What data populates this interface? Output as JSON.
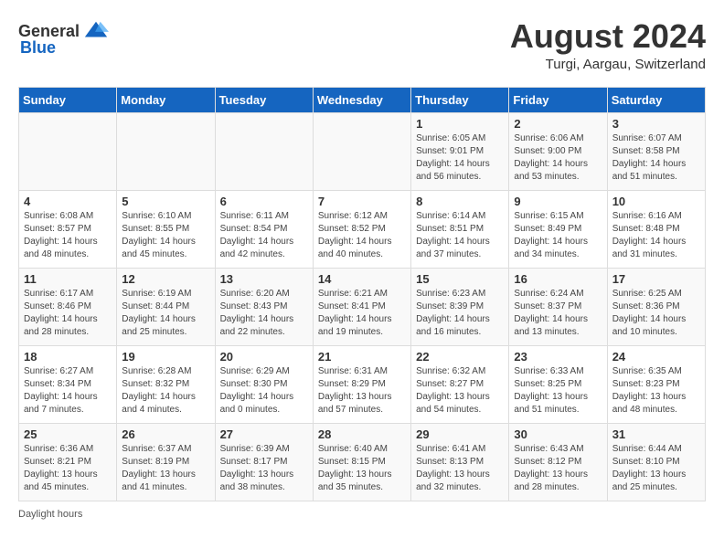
{
  "header": {
    "logo_general": "General",
    "logo_blue": "Blue",
    "month_title": "August 2024",
    "location": "Turgi, Aargau, Switzerland"
  },
  "columns": [
    "Sunday",
    "Monday",
    "Tuesday",
    "Wednesday",
    "Thursday",
    "Friday",
    "Saturday"
  ],
  "footer": {
    "label": "Daylight hours"
  },
  "weeks": [
    {
      "days": [
        {
          "num": "",
          "content": ""
        },
        {
          "num": "",
          "content": ""
        },
        {
          "num": "",
          "content": ""
        },
        {
          "num": "",
          "content": ""
        },
        {
          "num": "1",
          "content": "Sunrise: 6:05 AM\nSunset: 9:01 PM\nDaylight: 14 hours\nand 56 minutes."
        },
        {
          "num": "2",
          "content": "Sunrise: 6:06 AM\nSunset: 9:00 PM\nDaylight: 14 hours\nand 53 minutes."
        },
        {
          "num": "3",
          "content": "Sunrise: 6:07 AM\nSunset: 8:58 PM\nDaylight: 14 hours\nand 51 minutes."
        }
      ]
    },
    {
      "days": [
        {
          "num": "4",
          "content": "Sunrise: 6:08 AM\nSunset: 8:57 PM\nDaylight: 14 hours\nand 48 minutes."
        },
        {
          "num": "5",
          "content": "Sunrise: 6:10 AM\nSunset: 8:55 PM\nDaylight: 14 hours\nand 45 minutes."
        },
        {
          "num": "6",
          "content": "Sunrise: 6:11 AM\nSunset: 8:54 PM\nDaylight: 14 hours\nand 42 minutes."
        },
        {
          "num": "7",
          "content": "Sunrise: 6:12 AM\nSunset: 8:52 PM\nDaylight: 14 hours\nand 40 minutes."
        },
        {
          "num": "8",
          "content": "Sunrise: 6:14 AM\nSunset: 8:51 PM\nDaylight: 14 hours\nand 37 minutes."
        },
        {
          "num": "9",
          "content": "Sunrise: 6:15 AM\nSunset: 8:49 PM\nDaylight: 14 hours\nand 34 minutes."
        },
        {
          "num": "10",
          "content": "Sunrise: 6:16 AM\nSunset: 8:48 PM\nDaylight: 14 hours\nand 31 minutes."
        }
      ]
    },
    {
      "days": [
        {
          "num": "11",
          "content": "Sunrise: 6:17 AM\nSunset: 8:46 PM\nDaylight: 14 hours\nand 28 minutes."
        },
        {
          "num": "12",
          "content": "Sunrise: 6:19 AM\nSunset: 8:44 PM\nDaylight: 14 hours\nand 25 minutes."
        },
        {
          "num": "13",
          "content": "Sunrise: 6:20 AM\nSunset: 8:43 PM\nDaylight: 14 hours\nand 22 minutes."
        },
        {
          "num": "14",
          "content": "Sunrise: 6:21 AM\nSunset: 8:41 PM\nDaylight: 14 hours\nand 19 minutes."
        },
        {
          "num": "15",
          "content": "Sunrise: 6:23 AM\nSunset: 8:39 PM\nDaylight: 14 hours\nand 16 minutes."
        },
        {
          "num": "16",
          "content": "Sunrise: 6:24 AM\nSunset: 8:37 PM\nDaylight: 14 hours\nand 13 minutes."
        },
        {
          "num": "17",
          "content": "Sunrise: 6:25 AM\nSunset: 8:36 PM\nDaylight: 14 hours\nand 10 minutes."
        }
      ]
    },
    {
      "days": [
        {
          "num": "18",
          "content": "Sunrise: 6:27 AM\nSunset: 8:34 PM\nDaylight: 14 hours\nand 7 minutes."
        },
        {
          "num": "19",
          "content": "Sunrise: 6:28 AM\nSunset: 8:32 PM\nDaylight: 14 hours\nand 4 minutes."
        },
        {
          "num": "20",
          "content": "Sunrise: 6:29 AM\nSunset: 8:30 PM\nDaylight: 14 hours\nand 0 minutes."
        },
        {
          "num": "21",
          "content": "Sunrise: 6:31 AM\nSunset: 8:29 PM\nDaylight: 13 hours\nand 57 minutes."
        },
        {
          "num": "22",
          "content": "Sunrise: 6:32 AM\nSunset: 8:27 PM\nDaylight: 13 hours\nand 54 minutes."
        },
        {
          "num": "23",
          "content": "Sunrise: 6:33 AM\nSunset: 8:25 PM\nDaylight: 13 hours\nand 51 minutes."
        },
        {
          "num": "24",
          "content": "Sunrise: 6:35 AM\nSunset: 8:23 PM\nDaylight: 13 hours\nand 48 minutes."
        }
      ]
    },
    {
      "days": [
        {
          "num": "25",
          "content": "Sunrise: 6:36 AM\nSunset: 8:21 PM\nDaylight: 13 hours\nand 45 minutes."
        },
        {
          "num": "26",
          "content": "Sunrise: 6:37 AM\nSunset: 8:19 PM\nDaylight: 13 hours\nand 41 minutes."
        },
        {
          "num": "27",
          "content": "Sunrise: 6:39 AM\nSunset: 8:17 PM\nDaylight: 13 hours\nand 38 minutes."
        },
        {
          "num": "28",
          "content": "Sunrise: 6:40 AM\nSunset: 8:15 PM\nDaylight: 13 hours\nand 35 minutes."
        },
        {
          "num": "29",
          "content": "Sunrise: 6:41 AM\nSunset: 8:13 PM\nDaylight: 13 hours\nand 32 minutes."
        },
        {
          "num": "30",
          "content": "Sunrise: 6:43 AM\nSunset: 8:12 PM\nDaylight: 13 hours\nand 28 minutes."
        },
        {
          "num": "31",
          "content": "Sunrise: 6:44 AM\nSunset: 8:10 PM\nDaylight: 13 hours\nand 25 minutes."
        }
      ]
    }
  ]
}
